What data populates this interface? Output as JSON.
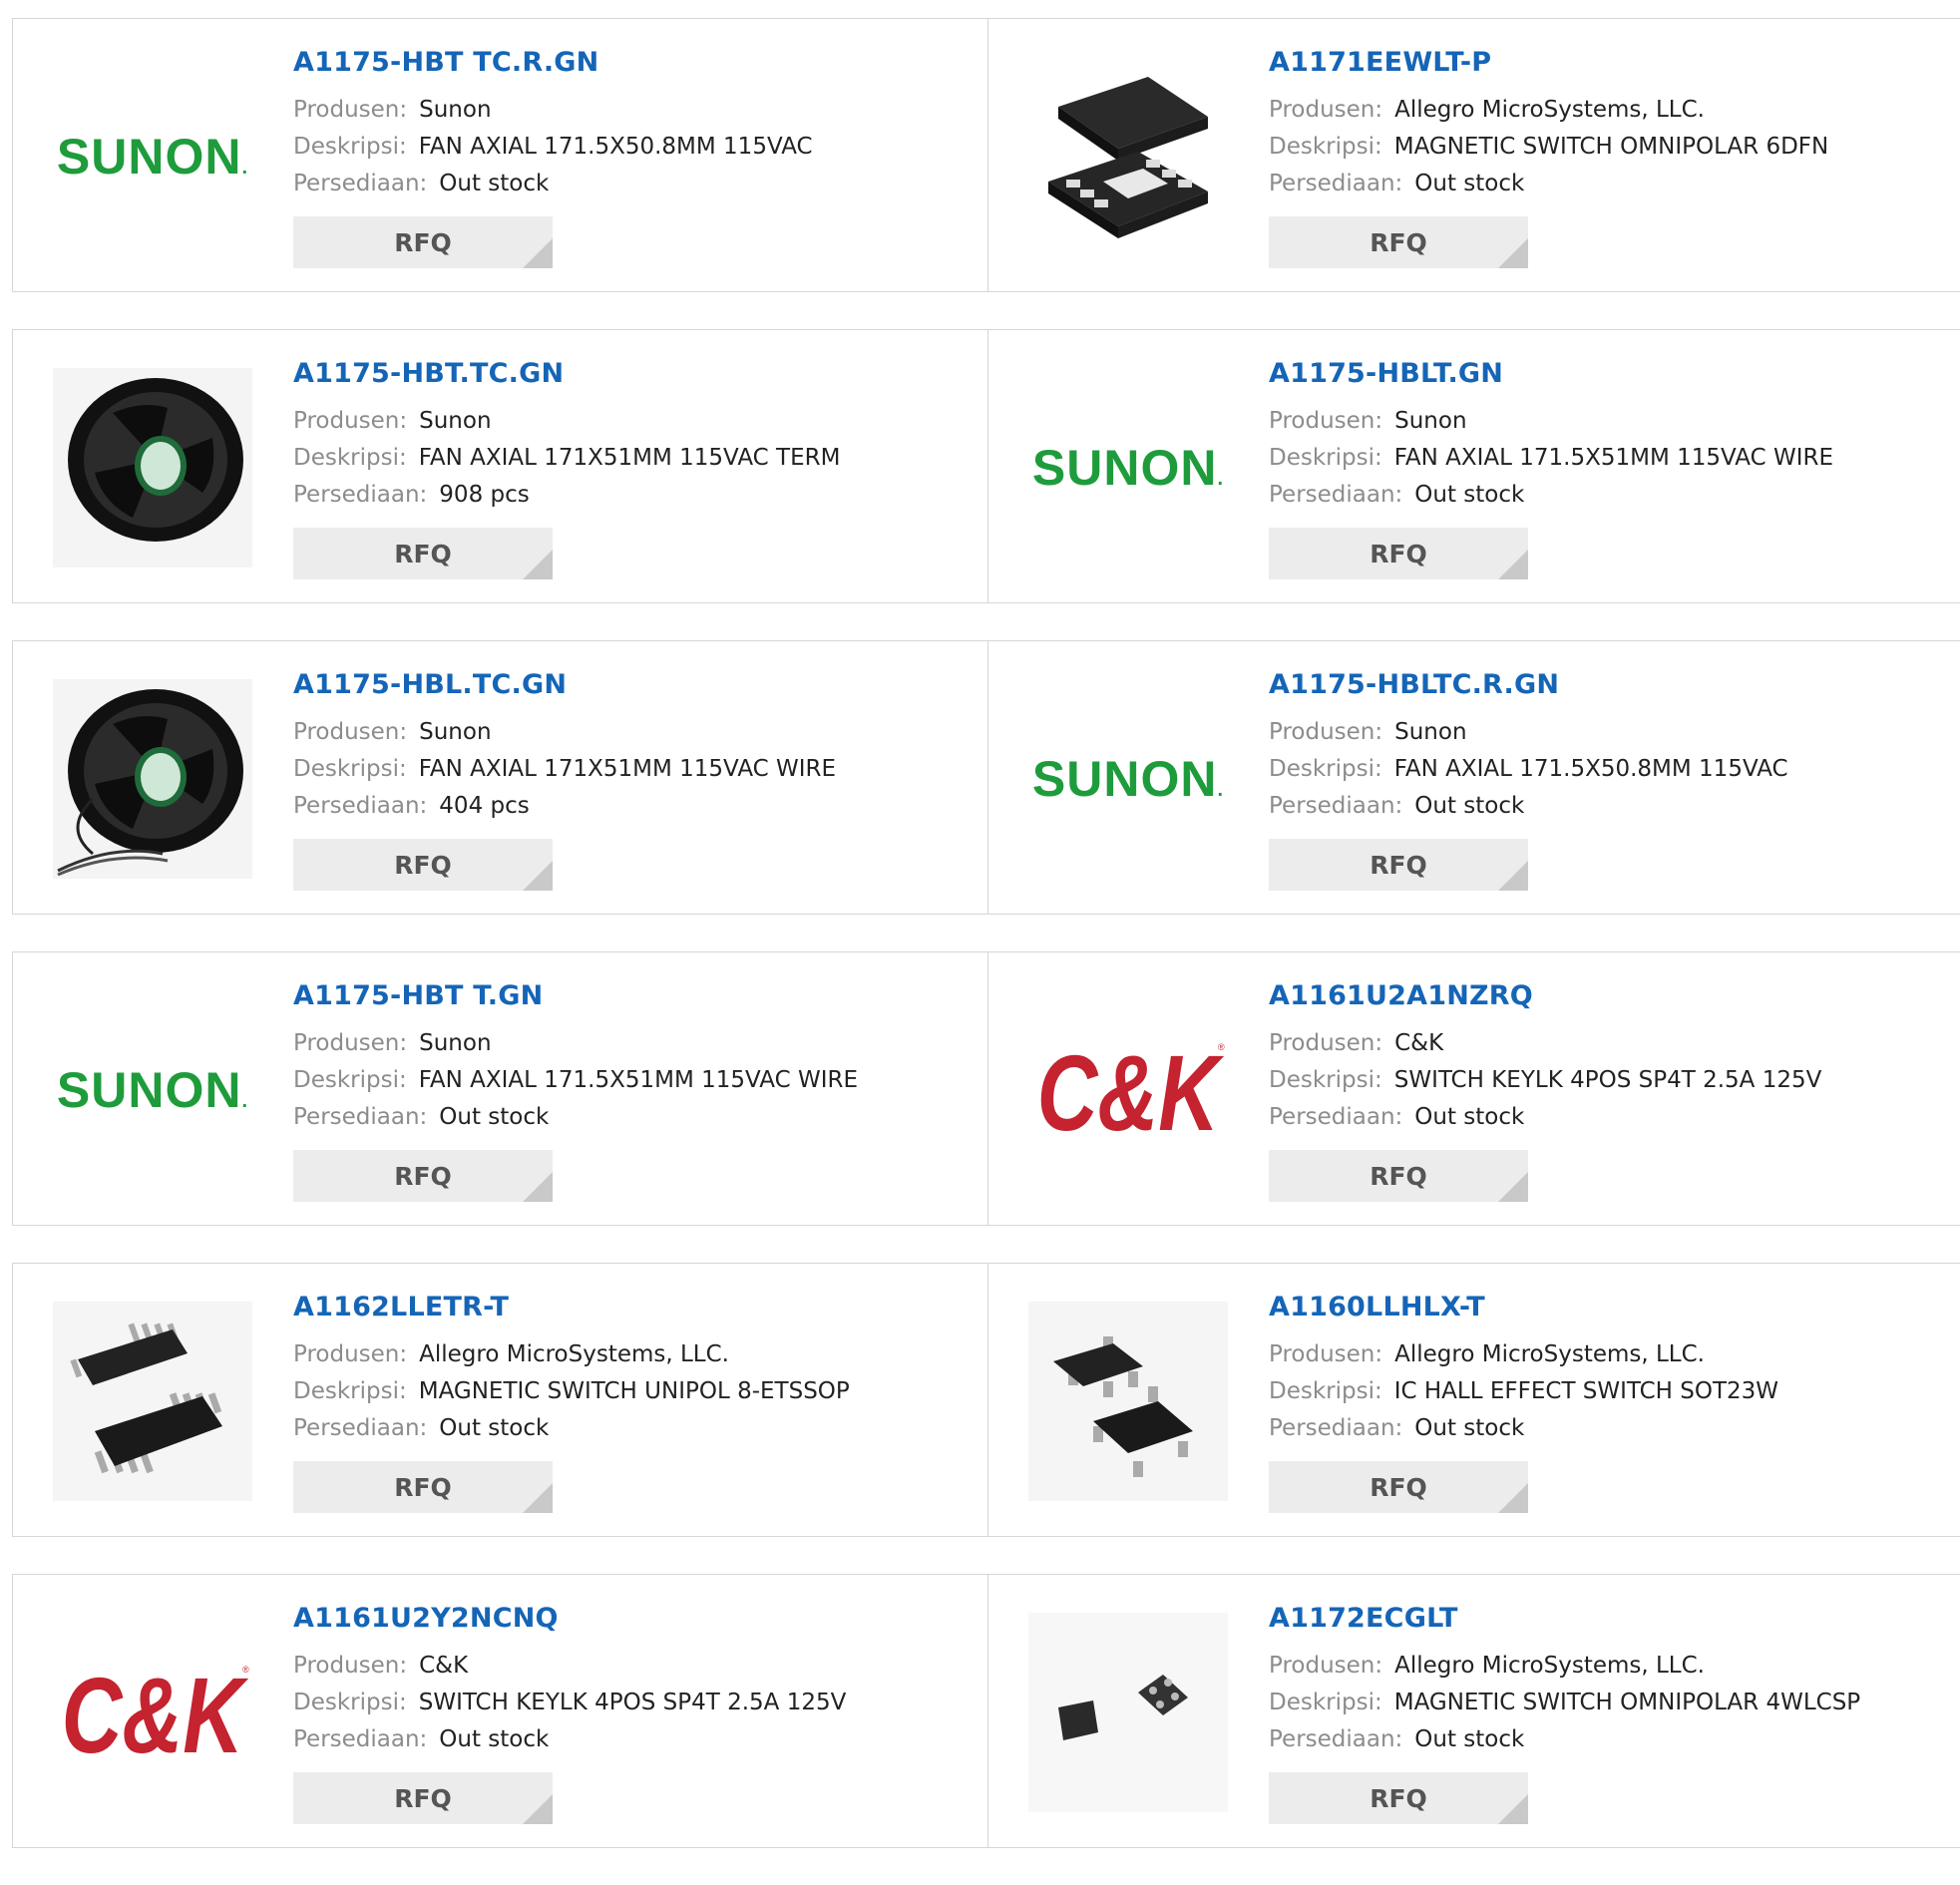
{
  "labels": {
    "manufacturer": "Produsen:",
    "description": "Deskripsi:",
    "stock": "Persediaan:"
  },
  "products": [
    {
      "part": "A1175-HBT TC.R.GN",
      "manufacturer": "Sunon",
      "description": "FAN AXIAL 171.5X50.8MM 115VAC",
      "stock": "Out stock",
      "rfq": "RFQ",
      "image": "sunon-logo"
    },
    {
      "part": "A1171EEWLT-P",
      "manufacturer": "Allegro MicroSystems, LLC.",
      "description": "MAGNETIC SWITCH OMNIPOLAR 6DFN",
      "stock": "Out stock",
      "rfq": "RFQ",
      "image": "dfn-chip"
    },
    {
      "part": "A1175-HBT.TC.GN",
      "manufacturer": "Sunon",
      "description": "FAN AXIAL 171X51MM 115VAC TERM",
      "stock": "908 pcs",
      "rfq": "RFQ",
      "image": "axial-fan"
    },
    {
      "part": "A1175-HBLT.GN",
      "manufacturer": "Sunon",
      "description": "FAN AXIAL 171.5X51MM 115VAC WIRE",
      "stock": "Out stock",
      "rfq": "RFQ",
      "image": "sunon-logo"
    },
    {
      "part": "A1175-HBL.TC.GN",
      "manufacturer": "Sunon",
      "description": "FAN AXIAL 171X51MM 115VAC WIRE",
      "stock": "404 pcs",
      "rfq": "RFQ",
      "image": "axial-fan-wired"
    },
    {
      "part": "A1175-HBLTC.R.GN",
      "manufacturer": "Sunon",
      "description": "FAN AXIAL 171.5X50.8MM 115VAC",
      "stock": "Out stock",
      "rfq": "RFQ",
      "image": "sunon-logo"
    },
    {
      "part": "A1175-HBT T.GN",
      "manufacturer": "Sunon",
      "description": "FAN AXIAL 171.5X51MM 115VAC WIRE",
      "stock": "Out stock",
      "rfq": "RFQ",
      "image": "sunon-logo"
    },
    {
      "part": "A1161U2A1NZRQ",
      "manufacturer": "C&K",
      "description": "SWITCH KEYLK 4POS SP4T 2.5A 125V",
      "stock": "Out stock",
      "rfq": "RFQ",
      "image": "ck-logo"
    },
    {
      "part": "A1162LLETR-T",
      "manufacturer": "Allegro MicroSystems, LLC.",
      "description": "MAGNETIC SWITCH UNIPOL 8-ETSSOP",
      "stock": "Out stock",
      "rfq": "RFQ",
      "image": "tssop-chip"
    },
    {
      "part": "A1160LLHLX-T",
      "manufacturer": "Allegro MicroSystems, LLC.",
      "description": "IC HALL EFFECT SWITCH SOT23W",
      "stock": "Out stock",
      "rfq": "RFQ",
      "image": "sot23-chip"
    },
    {
      "part": "A1161U2Y2NCNQ",
      "manufacturer": "C&K",
      "description": "SWITCH KEYLK 4POS SP4T 2.5A 125V",
      "stock": "Out stock",
      "rfq": "RFQ",
      "image": "ck-logo"
    },
    {
      "part": "A1172ECGLT",
      "manufacturer": "Allegro MicroSystems, LLC.",
      "description": "MAGNETIC SWITCH OMNIPOLAR 4WLCSP",
      "stock": "Out stock",
      "rfq": "RFQ",
      "image": "wlcsp-chip"
    }
  ],
  "logos": {
    "sunon": "SUNON",
    "ck": "C&K"
  },
  "colors": {
    "part_link": "#1565b7",
    "label": "#8c8c8c",
    "sunon_green": "#1e9c3c",
    "ck_red": "#c4232f",
    "button_bg": "#ececec"
  }
}
